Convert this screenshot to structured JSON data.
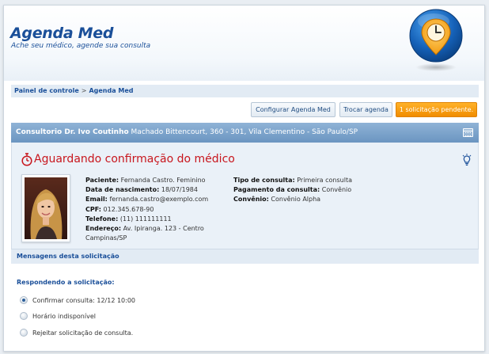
{
  "header": {
    "title": "Agenda Med",
    "subtitle": "Ache seu médico, agende sua consulta",
    "logo_icon": "clock-pin-icon"
  },
  "breadcrumb": {
    "items": [
      "Painel de controle",
      "Agenda Med"
    ],
    "separator": ">"
  },
  "toolbar": {
    "configure_label": "Configurar Agenda Med",
    "switch_label": "Trocar agenda",
    "pending_label": "1 solicitação pendente."
  },
  "clinic": {
    "name": "Consultorio Dr. Ivo Coutinho",
    "address": "Machado Bittencourt, 360 - 301, Vila Clementino - São Paulo/SP"
  },
  "status": {
    "title": "Aguardando confirmação do médico"
  },
  "patient": {
    "name_label": "Paciente:",
    "name": "Fernanda Castro. Feminino",
    "birth_label": "Data de nascimento:",
    "birth": "18/07/1984",
    "email_label": "Email:",
    "email": "fernanda.castro@exemplo.com",
    "cpf_label": "CPF:",
    "cpf": "012.345.678-90",
    "phone_label": "Telefone:",
    "phone": "(11) 111111111",
    "address_label": "Endereço:",
    "address": "Av. Ipiranga. 123 - Centro Campinas/SP"
  },
  "consultation": {
    "type_label": "Tipo de consulta:",
    "type": "Primeira consulta",
    "payment_label": "Pagamento da consulta:",
    "payment": "Convênio",
    "insurance_label": "Convênio:",
    "insurance": "Convênio Alpha"
  },
  "messages": {
    "section_title": "Mensagens desta solicitação",
    "responding_label": "Respondendo a solicitação:",
    "options": [
      {
        "label": "Confirmar consulta: 12/12 10:00",
        "checked": true
      },
      {
        "label": "Horário indisponível",
        "checked": false
      },
      {
        "label": "Rejeitar solicitação de consulta.",
        "checked": false
      }
    ]
  },
  "colors": {
    "brand": "#1a4f99",
    "accent": "#f08c00",
    "alert": "#c8161d",
    "bar": "#6b95c1"
  }
}
